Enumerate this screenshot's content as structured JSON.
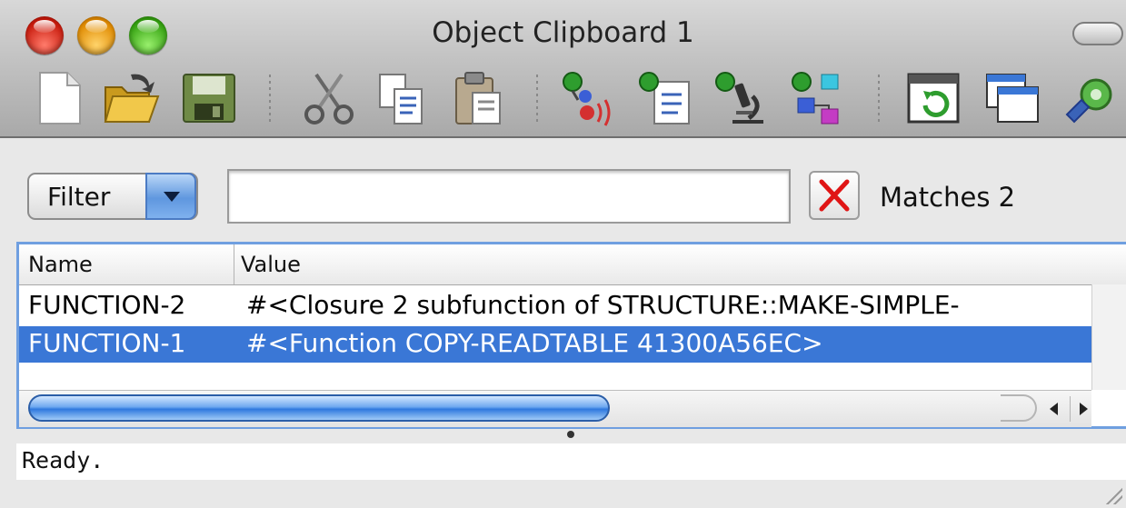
{
  "window": {
    "title": "Object Clipboard 1"
  },
  "toolbar": {
    "groups": [
      [
        "new-document-icon",
        "open-folder-icon",
        "save-disk-icon"
      ],
      [
        "cut-scissors-icon",
        "copy-icon",
        "paste-icon"
      ],
      [
        "inspect-signal-icon",
        "inspect-list-icon",
        "inspect-microscope-icon",
        "inspect-graph-icon"
      ],
      [
        "refresh-window-icon",
        "new-window-icon",
        "preferences-gear-icon"
      ]
    ]
  },
  "filter": {
    "mode_label": "Filter",
    "search_value": "",
    "search_placeholder": "",
    "matches_label": "Matches",
    "matches_count": "2"
  },
  "table": {
    "columns": [
      "Name",
      "Value"
    ],
    "rows": [
      {
        "name": "FUNCTION-2",
        "value": "#<Closure 2 subfunction of STRUCTURE::MAKE-SIMPLE-",
        "selected": false
      },
      {
        "name": "FUNCTION-1",
        "value": "#<Function COPY-READTABLE 41300A56EC>",
        "selected": true
      }
    ],
    "selection_color": "#3a77d6"
  },
  "status": {
    "text": "Ready."
  }
}
